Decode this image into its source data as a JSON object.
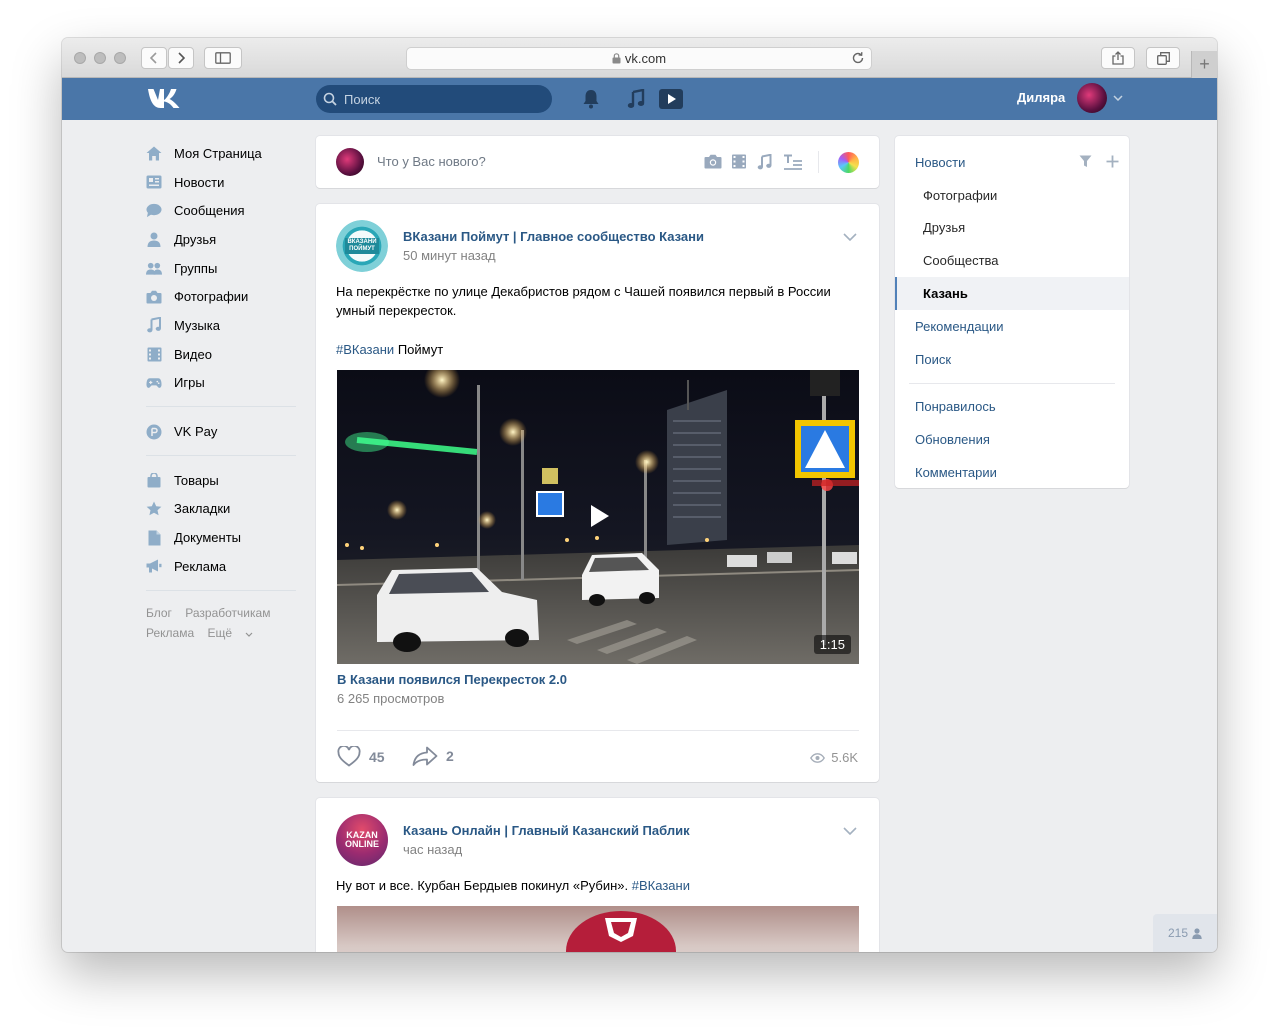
{
  "browser": {
    "url": "vk.com"
  },
  "header": {
    "search_placeholder": "Поиск",
    "user_name": "Диляра"
  },
  "left_nav": {
    "main": [
      {
        "label": "Моя Страница",
        "icon": "home-icon"
      },
      {
        "label": "Новости",
        "icon": "news-icon"
      },
      {
        "label": "Сообщения",
        "icon": "messages-icon"
      },
      {
        "label": "Друзья",
        "icon": "friends-icon"
      },
      {
        "label": "Группы",
        "icon": "groups-icon"
      },
      {
        "label": "Фотографии",
        "icon": "camera-icon"
      },
      {
        "label": "Музыка",
        "icon": "music-icon"
      },
      {
        "label": "Видео",
        "icon": "video-icon"
      },
      {
        "label": "Игры",
        "icon": "gamepad-icon"
      }
    ],
    "pay": {
      "label": "VK Pay",
      "icon": "vkpay-icon"
    },
    "extra": [
      {
        "label": "Товары",
        "icon": "bag-icon"
      },
      {
        "label": "Закладки",
        "icon": "star-icon"
      },
      {
        "label": "Документы",
        "icon": "document-icon"
      },
      {
        "label": "Реклама",
        "icon": "megaphone-icon"
      }
    ],
    "footer": {
      "blog": "Блог",
      "developers": "Разработчикам",
      "ads": "Реклама",
      "more": "Ещё"
    }
  },
  "composer": {
    "placeholder": "Что у Вас нового?"
  },
  "posts": [
    {
      "author": "ВКазани Поймут | Главное сообщество Казани",
      "time": "50 минут назад",
      "text": "На перекрёстке по улице Декабристов рядом с Чашей появился первый в России умный перекресток.",
      "hashtag": "#ВКазани",
      "hashtag_tail": "Поймут",
      "avatar_text": "ВКАЗАНИ ПОЙМУТ",
      "video": {
        "duration": "1:15",
        "title": "В Казани появился Перекресток 2.0",
        "views": "6 265 просмотров"
      },
      "likes": "45",
      "shares": "2",
      "views": "5.6K"
    },
    {
      "author": "Казань Онлайн | Главный Казанский Паблик",
      "time": "час назад",
      "text": "Ну вот и все. Курбан Бердыев покинул «Рубин».",
      "hashtag": "#ВКазани",
      "avatar_text_1": "KAZAN",
      "avatar_text_2": "ONLINE"
    }
  ],
  "right_menu": {
    "title": "Новости",
    "sub": [
      "Фотографии",
      "Друзья",
      "Сообщества"
    ],
    "active": "Казань",
    "links": [
      "Рекомендации",
      "Поиск"
    ],
    "links2": [
      "Понравилось",
      "Обновления",
      "Комментарии"
    ]
  },
  "online_counter": "215",
  "colors": {
    "vk_blue": "#4a76a8",
    "link": "#2a5885",
    "bg": "#edeef0"
  }
}
